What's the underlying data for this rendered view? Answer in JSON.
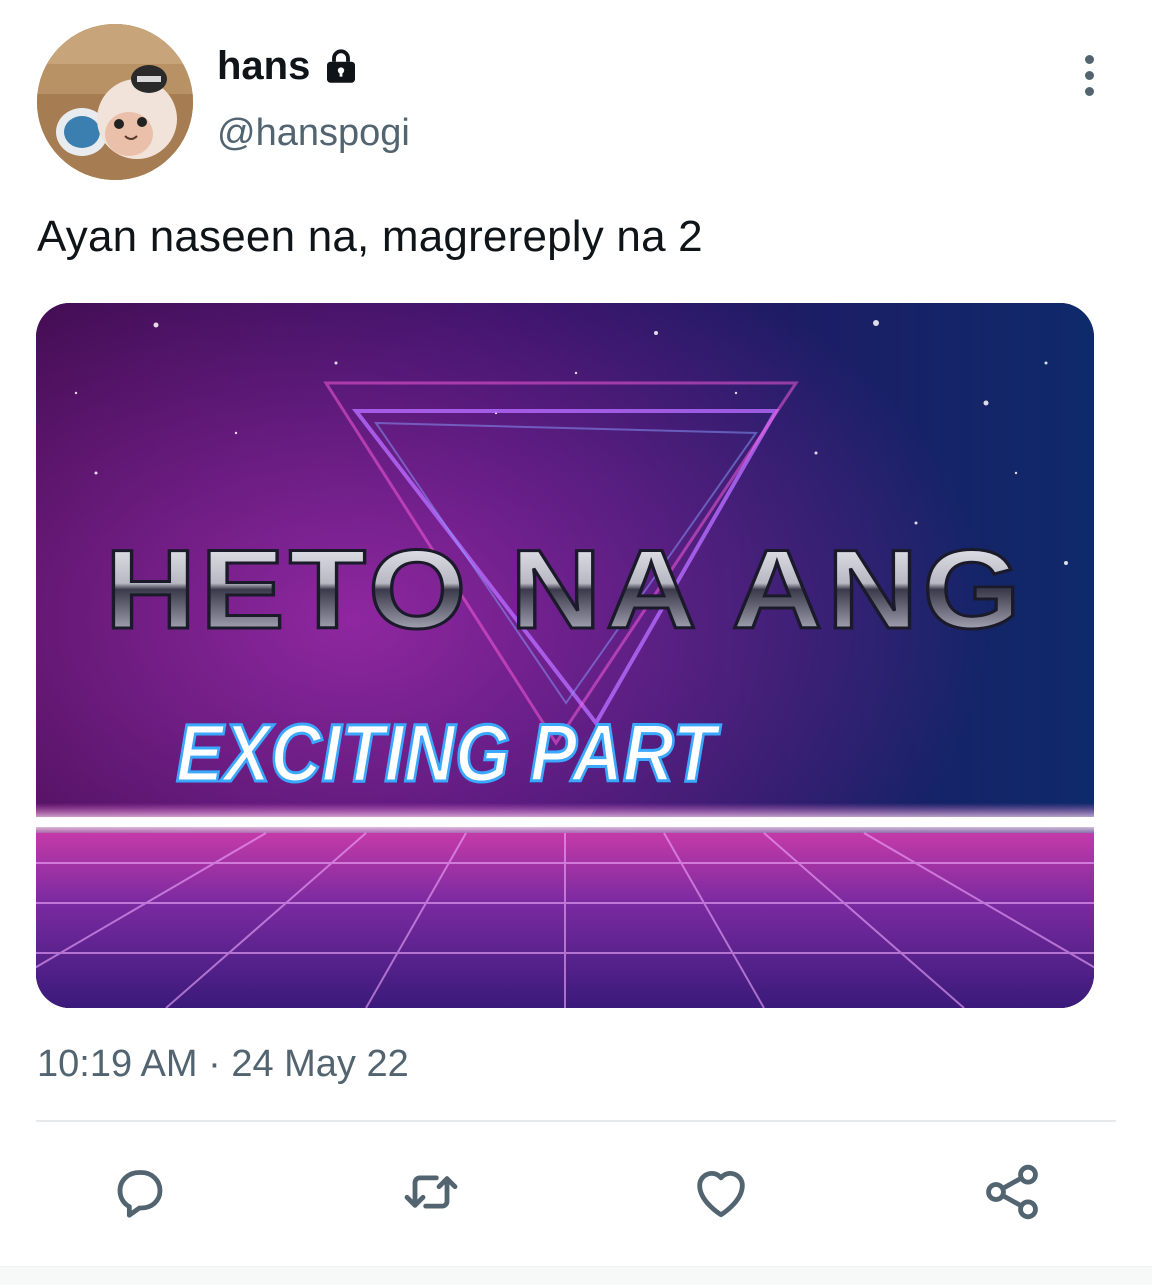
{
  "author": {
    "display_name": "hans",
    "handle": "@hanspogi",
    "protected": true
  },
  "tweet": {
    "text": "Ayan naseen na, magrereply na 2",
    "timestamp": "10:19 AM · 24 May 22"
  },
  "media": {
    "title_line": "HETO NA ANG",
    "subtitle_line": "EXCITING PART"
  },
  "icons": {
    "lock": "lock-icon",
    "more": "more-vertical-icon",
    "reply": "reply-icon",
    "retweet": "retweet-icon",
    "like": "heart-icon",
    "share": "share-icon"
  },
  "colors": {
    "text_primary": "#0f1419",
    "text_secondary": "#536471",
    "icon": "#536471"
  }
}
